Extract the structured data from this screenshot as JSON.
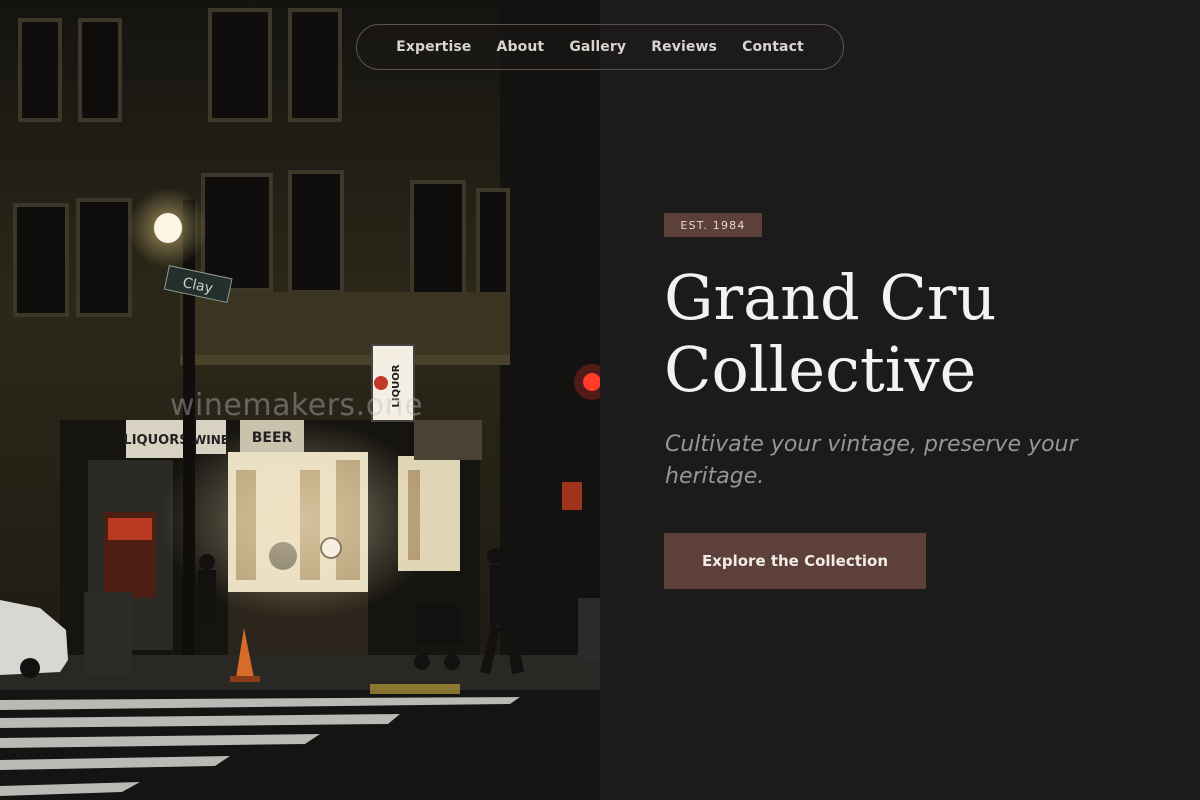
{
  "nav": {
    "items": [
      {
        "label": "Expertise"
      },
      {
        "label": "About"
      },
      {
        "label": "Gallery"
      },
      {
        "label": "Reviews"
      },
      {
        "label": "Contact"
      }
    ]
  },
  "hero": {
    "badge": "EST. 1984",
    "title_line1": "Grand Cru",
    "title_line2": "Collective",
    "subtitle": "Cultivate your vintage, preserve your heritage.",
    "cta_label": "Explore the Collection"
  },
  "photo": {
    "watermark": "winemakers.one",
    "street_sign": "Clay",
    "store_sign_liquors": "LIQUORS",
    "store_sign_beer": "BEER",
    "store_sign_wine": "WINE",
    "corner_sign": "LIQUOR"
  },
  "colors": {
    "background": "#1c1b1b",
    "accent": "#5c4039",
    "title": "#f4f1ee",
    "subtitle": "#9a9591"
  }
}
